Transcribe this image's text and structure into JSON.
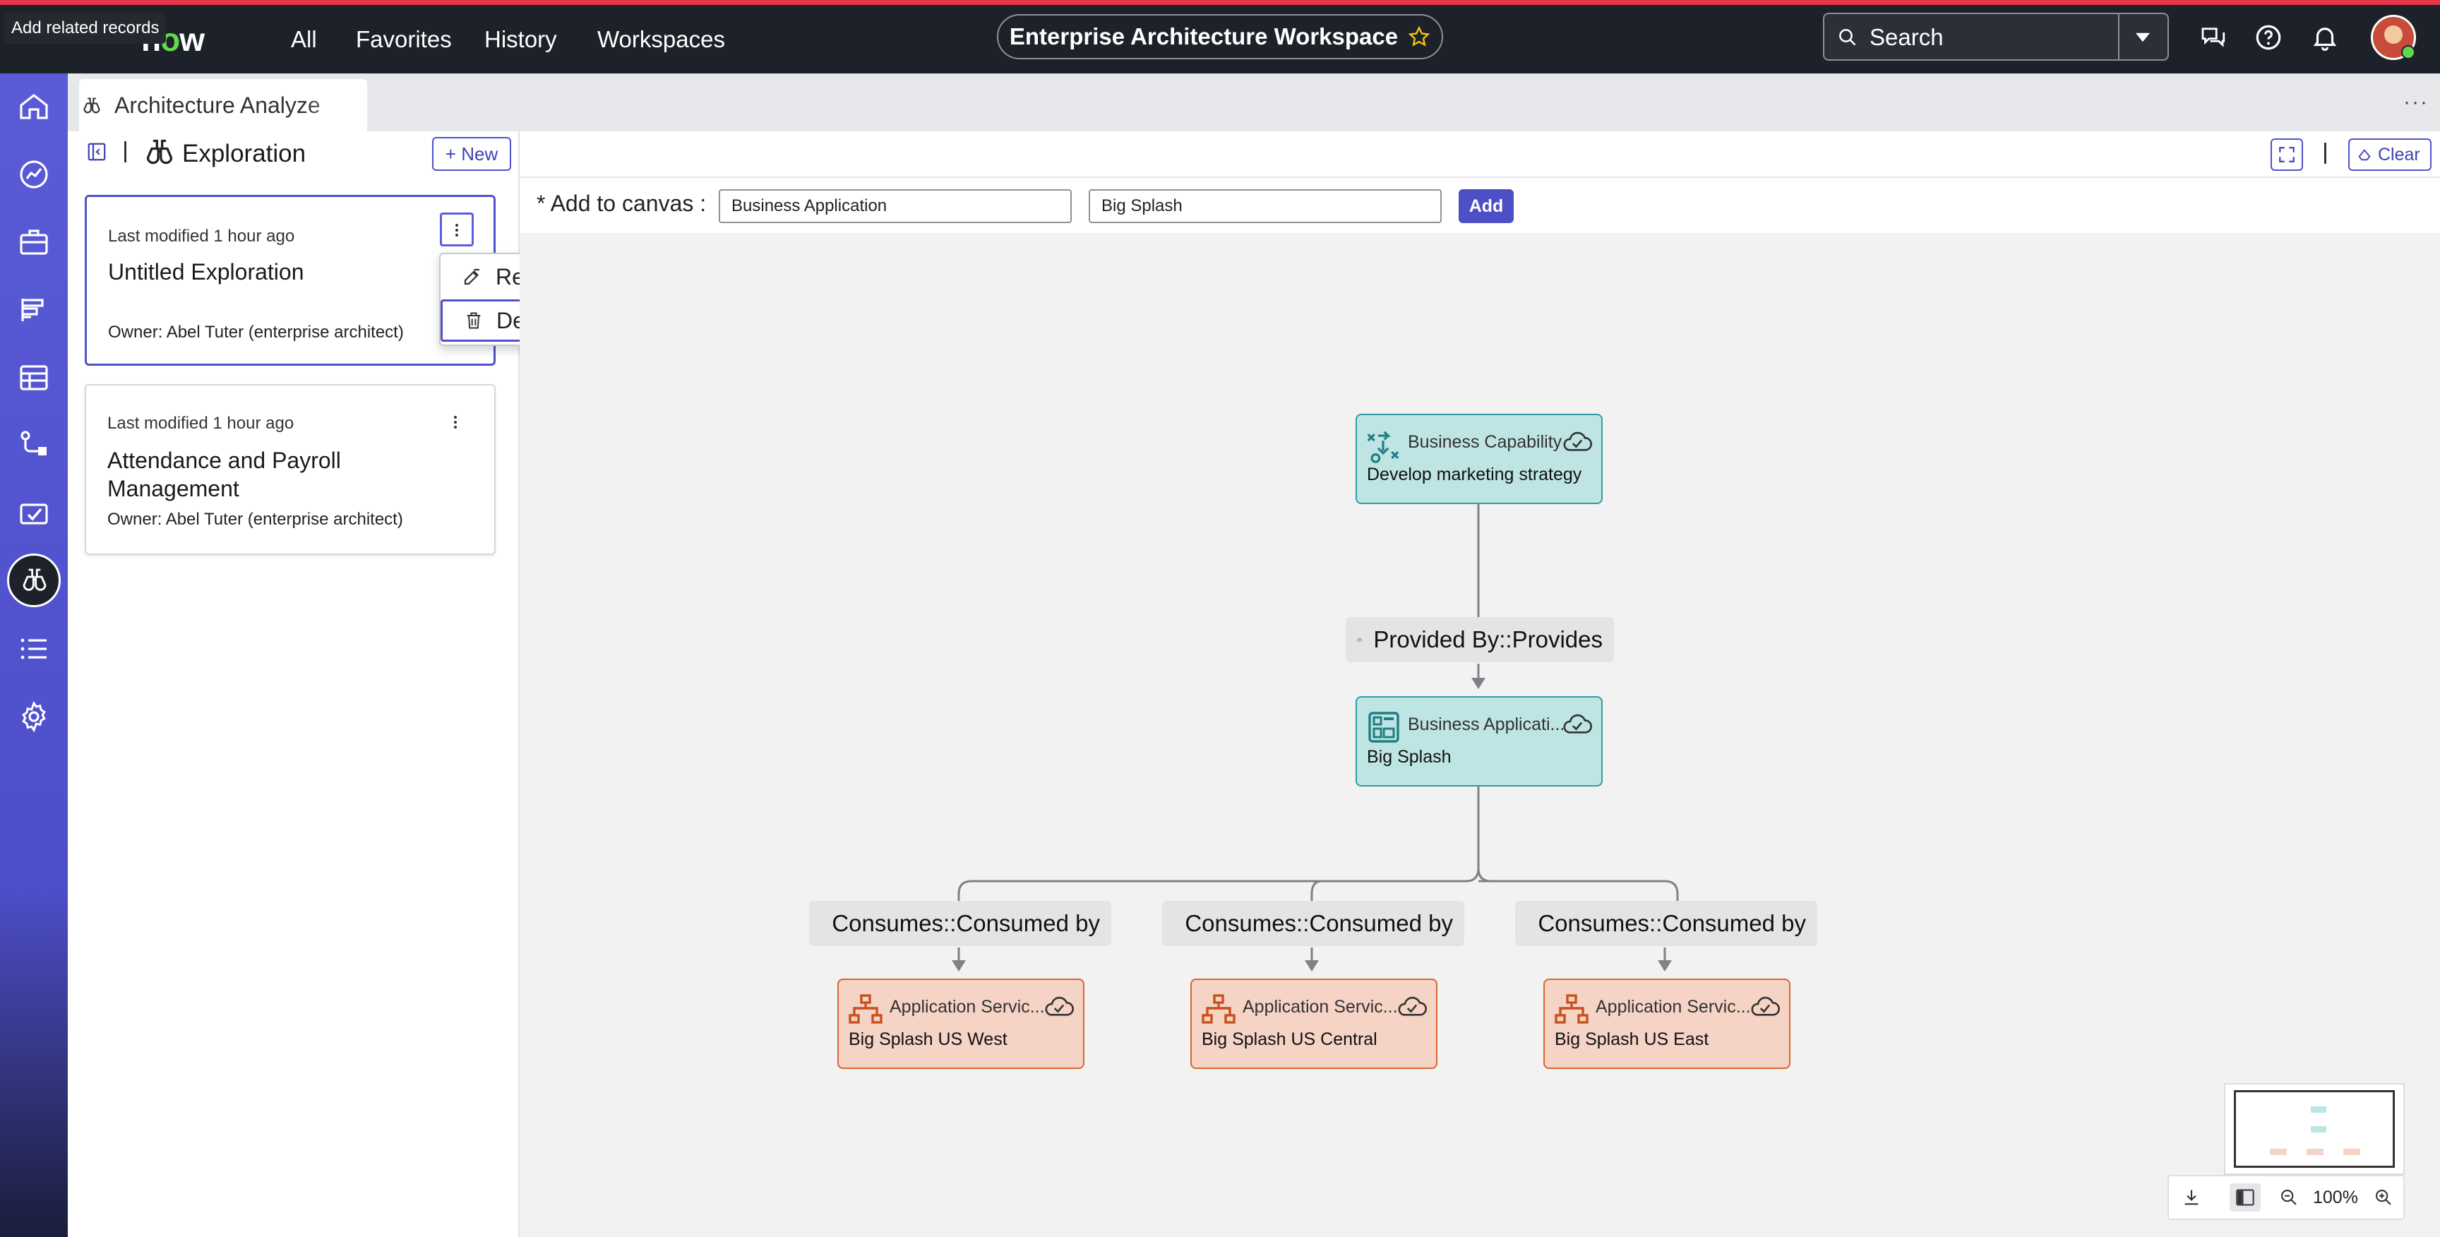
{
  "tooltip": "Add related records",
  "header": {
    "logo_prefix": "n",
    "logo_o": "o",
    "logo_suffix": "w",
    "nav": [
      "All",
      "Favorites",
      "History",
      "Workspaces"
    ],
    "workspace_title": "Enterprise Architecture Workspace",
    "search_placeholder": "Search",
    "accent_color": "#e8364a"
  },
  "tab": {
    "label": "Architecture Analyze"
  },
  "explorations": {
    "title": "Exploration",
    "new_label": "New",
    "cards": [
      {
        "modified": "Last modified 1 hour ago",
        "title": "Untitled Exploration",
        "owner": "Owner: Abel Tuter (enterprise architect)"
      },
      {
        "modified": "Last modified 1 hour ago",
        "title": "Attendance and Payroll Management",
        "owner": "Owner: Abel Tuter (enterprise architect)"
      }
    ],
    "menu": {
      "rename": "Rename",
      "delete": "Delete"
    }
  },
  "toolbar": {
    "clear_label": "Clear"
  },
  "add_canvas": {
    "label": "* Add to canvas :",
    "class_value": "Business Application",
    "record_value": "Big Splash",
    "add_label": "Add"
  },
  "graph": {
    "capability": {
      "type": "Business Capability",
      "name": "Develop marketing strategy"
    },
    "edge_provided": "Provided By::Provides",
    "application": {
      "type": "Business Applicati...",
      "name": "Big Splash"
    },
    "edge_consumes": "Consumes::Consumed by",
    "services": [
      {
        "type": "Application Servic...",
        "name": "Big Splash US West"
      },
      {
        "type": "Application Servic...",
        "name": "Big Splash US Central"
      },
      {
        "type": "Application Servic...",
        "name": "Big Splash US East"
      }
    ]
  },
  "zoom": {
    "level": "100%"
  }
}
